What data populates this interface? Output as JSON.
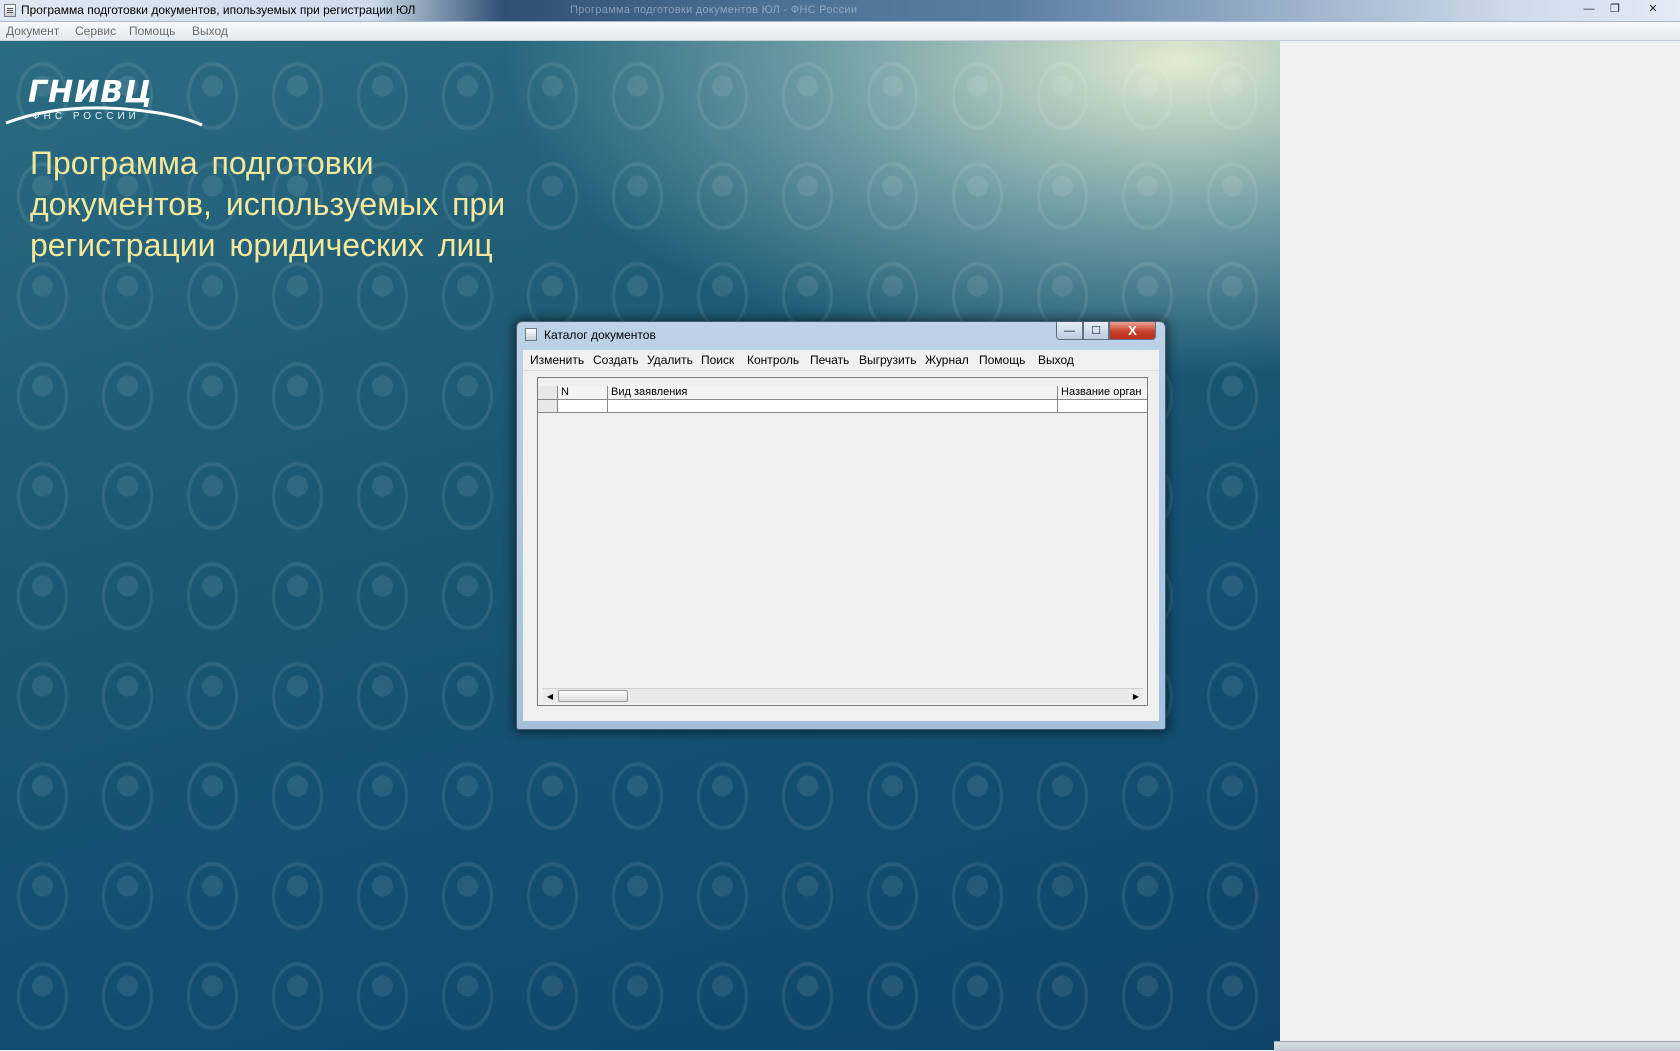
{
  "app": {
    "title": "Программа подготовки документов, ипользуемых при регистрации ЮЛ",
    "title_blur": "Программа подготовки документов ЮЛ - ФНС России",
    "controls": {
      "minimize": "—",
      "restore": "❐",
      "close": "✕"
    },
    "menu": [
      "Документ",
      "Сервис",
      "Помощь",
      "Выход"
    ]
  },
  "branding": {
    "logo": "ГНИВЦ",
    "logo_sub": "ФНС РОССИИ",
    "heading": "Программа подготовки документов, используемых при регистрации юридических лиц"
  },
  "catalog_window": {
    "title": "Каталог документов",
    "controls": {
      "minimize": "—",
      "maximize": "☐",
      "close": "X"
    },
    "menu": [
      "Изменить",
      "Создать",
      "Удалить",
      "Поиск",
      "Контроль",
      "Печать",
      "Выгрузить",
      "Журнал",
      "Помощь",
      "Выход"
    ],
    "columns": [
      "N",
      "Вид заявления",
      "Название орган"
    ],
    "scroll": {
      "left": "◀",
      "right": "▶"
    }
  },
  "colors": {
    "heading": "#f2e79b",
    "background_dark": "#135072",
    "background_light": "#ecf2d6"
  }
}
